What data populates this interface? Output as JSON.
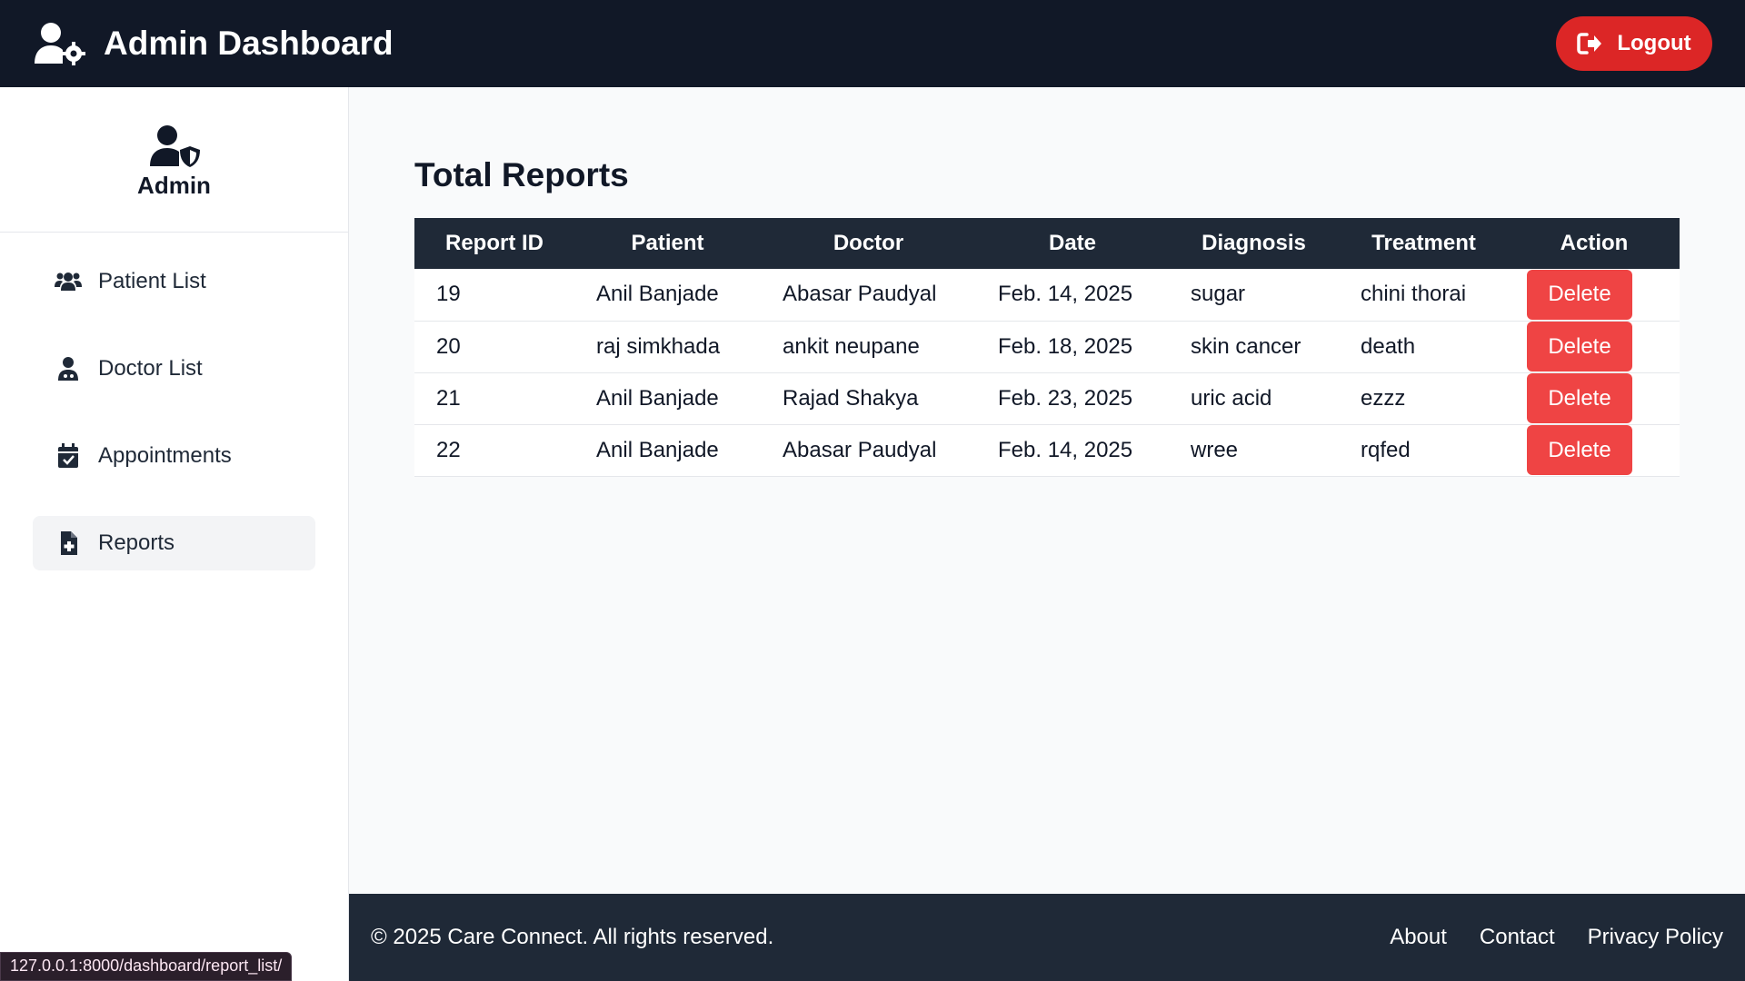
{
  "header": {
    "title": "Admin Dashboard",
    "logout_label": "Logout"
  },
  "sidebar": {
    "profile_name": "Admin",
    "items": [
      {
        "label": "Patient List",
        "icon": "users-icon"
      },
      {
        "label": "Doctor List",
        "icon": "doctor-icon"
      },
      {
        "label": "Appointments",
        "icon": "calendar-check-icon"
      },
      {
        "label": "Reports",
        "icon": "file-medical-icon",
        "active": true
      }
    ]
  },
  "main": {
    "title": "Total Reports",
    "columns": [
      "Report ID",
      "Patient",
      "Doctor",
      "Date",
      "Diagnosis",
      "Treatment",
      "Action"
    ],
    "rows": [
      {
        "id": "19",
        "patient": "Anil Banjade",
        "doctor": "Abasar Paudyal",
        "date": "Feb. 14, 2025",
        "diagnosis": "sugar",
        "treatment": "chini thorai",
        "action": "Delete"
      },
      {
        "id": "20",
        "patient": "raj simkhada",
        "doctor": "ankit neupane",
        "date": "Feb. 18, 2025",
        "diagnosis": "skin cancer",
        "treatment": "death",
        "action": "Delete"
      },
      {
        "id": "21",
        "patient": "Anil Banjade",
        "doctor": "Rajad Shakya",
        "date": "Feb. 23, 2025",
        "diagnosis": "uric acid",
        "treatment": "ezzz",
        "action": "Delete"
      },
      {
        "id": "22",
        "patient": "Anil Banjade",
        "doctor": "Abasar Paudyal",
        "date": "Feb. 14, 2025",
        "diagnosis": "wree",
        "treatment": "rqfed",
        "action": "Delete"
      }
    ]
  },
  "footer": {
    "copyright": "© 2025 Care Connect. All rights reserved.",
    "links": [
      "About",
      "Contact",
      "Privacy Policy"
    ]
  },
  "status_bar": {
    "url": "127.0.0.1:8000/dashboard/report_list/"
  },
  "colors": {
    "header_bg": "#111827",
    "accent_red": "#dc2626",
    "delete_red": "#ef4444",
    "footer_bg": "#1f2937"
  }
}
